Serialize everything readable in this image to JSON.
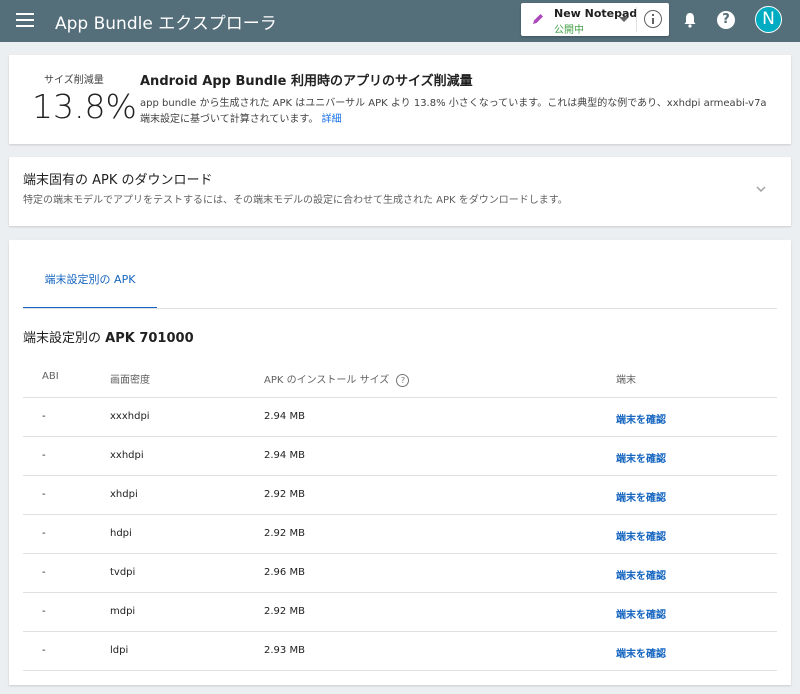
{
  "header": {
    "title": "App Bundle エクスプローラ",
    "app_name": "New Notepad",
    "app_status": "公開中",
    "help_glyph": "?",
    "avatar_letter": "N"
  },
  "savings": {
    "label": "サイズ削減量",
    "value": "13.8%",
    "title": "Android App Bundle 利用時のアプリのサイズ削減量",
    "description": "app bundle から生成された APK はユニバーサル APK より 13.8% 小さくなっています。これは典型的な例であり、xxhdpi armeabi-v7a 端末設定に基づいて計算されています。",
    "learn_more": "詳細"
  },
  "download": {
    "title": "端末固有の APK のダウンロード",
    "description": "特定の端末モデルでアプリをテストするには、その端末モデルの設定に合わせて生成された APK をダウンロードします。"
  },
  "tabs": [
    {
      "label": "端末設定別の APK"
    }
  ],
  "table": {
    "title_prefix": "端末設定別の",
    "title_strong": "APK 701000",
    "headers": {
      "abi": "ABI",
      "density": "画面密度",
      "size": "APK のインストール サイズ",
      "size_help": "?",
      "device": "端末"
    },
    "rows": [
      {
        "abi": "-",
        "density": "xxxhdpi",
        "size": "2.94 MB",
        "action": "端末を確認"
      },
      {
        "abi": "-",
        "density": "xxhdpi",
        "size": "2.94 MB",
        "action": "端末を確認"
      },
      {
        "abi": "-",
        "density": "xhdpi",
        "size": "2.92 MB",
        "action": "端末を確認"
      },
      {
        "abi": "-",
        "density": "hdpi",
        "size": "2.92 MB",
        "action": "端末を確認"
      },
      {
        "abi": "-",
        "density": "tvdpi",
        "size": "2.96 MB",
        "action": "端末を確認"
      },
      {
        "abi": "-",
        "density": "mdpi",
        "size": "2.92 MB",
        "action": "端末を確認"
      },
      {
        "abi": "-",
        "density": "ldpi",
        "size": "2.93 MB",
        "action": "端末を確認"
      }
    ]
  },
  "colors": {
    "topbar": "#546e7a",
    "accent": "#1565c0",
    "published": "#43a047",
    "avatar": "#00acc1"
  }
}
